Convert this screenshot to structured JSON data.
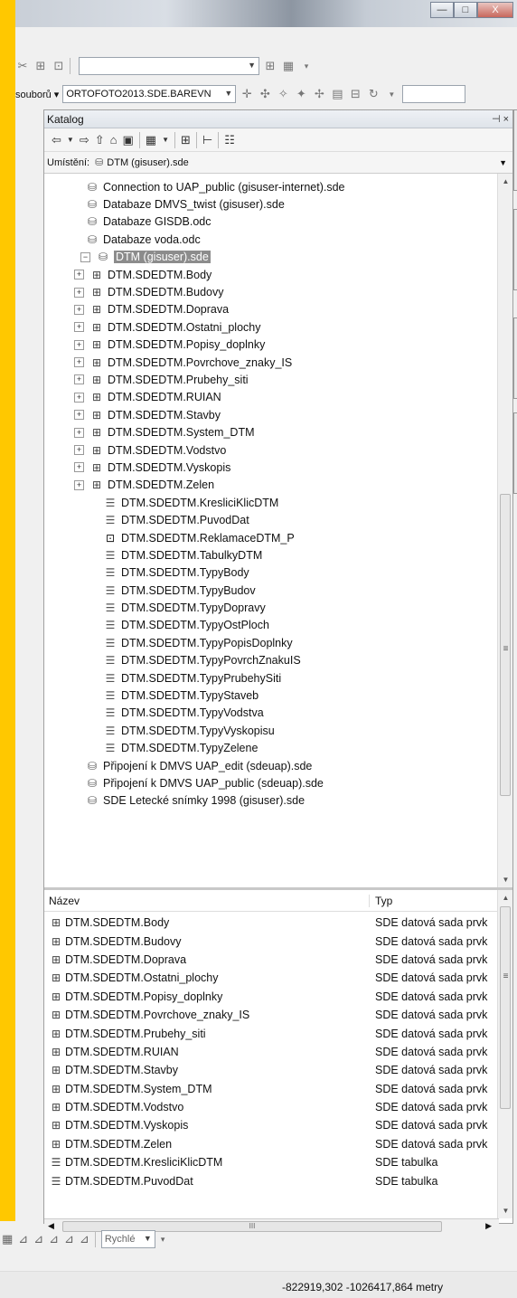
{
  "window": {
    "minimize": "—",
    "maximize": "□",
    "close": "X"
  },
  "top_toolbar": {
    "layer_combo_value": "ORTOFOTO2013.SDE.BAREVN",
    "label_prefix": "souborů ▾"
  },
  "catalog": {
    "title": "Katalog",
    "pin_label": "⊣ ×",
    "location_label": "Umístění:",
    "location_value": "DTM (gisuser).sde",
    "tree": [
      {
        "type": "db",
        "label": "Connection to UAP_public (gisuser-internet).sde",
        "indent": 1
      },
      {
        "type": "db",
        "label": "Databaze DMVS_twist (gisuser).sde",
        "indent": 1
      },
      {
        "type": "db",
        "label": "Databaze GISDB.odc",
        "indent": 1
      },
      {
        "type": "db",
        "label": "Databaze voda.odc",
        "indent": 1
      },
      {
        "type": "db-open",
        "label": "DTM (gisuser).sde",
        "indent": 0,
        "selected": true
      },
      {
        "type": "fds",
        "label": "DTM.SDEDTM.Body",
        "indent": 2
      },
      {
        "type": "fds",
        "label": "DTM.SDEDTM.Budovy",
        "indent": 2
      },
      {
        "type": "fds",
        "label": "DTM.SDEDTM.Doprava",
        "indent": 2
      },
      {
        "type": "fds",
        "label": "DTM.SDEDTM.Ostatni_plochy",
        "indent": 2
      },
      {
        "type": "fds",
        "label": "DTM.SDEDTM.Popisy_doplnky",
        "indent": 2
      },
      {
        "type": "fds",
        "label": "DTM.SDEDTM.Povrchove_znaky_IS",
        "indent": 2
      },
      {
        "type": "fds",
        "label": "DTM.SDEDTM.Prubehy_siti",
        "indent": 2
      },
      {
        "type": "fds",
        "label": "DTM.SDEDTM.RUIAN",
        "indent": 2
      },
      {
        "type": "fds",
        "label": "DTM.SDEDTM.Stavby",
        "indent": 2
      },
      {
        "type": "fds",
        "label": "DTM.SDEDTM.System_DTM",
        "indent": 2
      },
      {
        "type": "fds",
        "label": "DTM.SDEDTM.Vodstvo",
        "indent": 2
      },
      {
        "type": "fds",
        "label": "DTM.SDEDTM.Vyskopis",
        "indent": 2
      },
      {
        "type": "fds",
        "label": "DTM.SDEDTM.Zelen",
        "indent": 2
      },
      {
        "type": "tbl",
        "label": "DTM.SDEDTM.KresliciKlicDTM",
        "indent": 3
      },
      {
        "type": "tbl",
        "label": "DTM.SDEDTM.PuvodDat",
        "indent": 3
      },
      {
        "type": "fc",
        "label": "DTM.SDEDTM.ReklamaceDTM_P",
        "indent": 3
      },
      {
        "type": "tbl",
        "label": "DTM.SDEDTM.TabulkyDTM",
        "indent": 3
      },
      {
        "type": "tbl",
        "label": "DTM.SDEDTM.TypyBody",
        "indent": 3
      },
      {
        "type": "tbl",
        "label": "DTM.SDEDTM.TypyBudov",
        "indent": 3
      },
      {
        "type": "tbl",
        "label": "DTM.SDEDTM.TypyDopravy",
        "indent": 3
      },
      {
        "type": "tbl",
        "label": "DTM.SDEDTM.TypyOstPloch",
        "indent": 3
      },
      {
        "type": "tbl",
        "label": "DTM.SDEDTM.TypyPopisDoplnky",
        "indent": 3
      },
      {
        "type": "tbl",
        "label": "DTM.SDEDTM.TypyPovrchZnakuIS",
        "indent": 3
      },
      {
        "type": "tbl",
        "label": "DTM.SDEDTM.TypyPrubehySiti",
        "indent": 3
      },
      {
        "type": "tbl",
        "label": "DTM.SDEDTM.TypyStaveb",
        "indent": 3
      },
      {
        "type": "tbl",
        "label": "DTM.SDEDTM.TypyVodstva",
        "indent": 3
      },
      {
        "type": "tbl",
        "label": "DTM.SDEDTM.TypyVyskopisu",
        "indent": 3
      },
      {
        "type": "tbl",
        "label": "DTM.SDEDTM.TypyZelene",
        "indent": 3
      },
      {
        "type": "db",
        "label": "Připojení k DMVS UAP_edit (sdeuap).sde",
        "indent": 1
      },
      {
        "type": "db",
        "label": "Připojení k DMVS UAP_public (sdeuap).sde",
        "indent": 1
      },
      {
        "type": "db",
        "label": "SDE Letecké snímky 1998 (gisuser).sde",
        "indent": 1
      }
    ],
    "list_headers": {
      "name": "Název",
      "type": "Typ"
    },
    "list": [
      {
        "icon": "fds",
        "name": "DTM.SDEDTM.Body",
        "type": "SDE datová sada prvk"
      },
      {
        "icon": "fds",
        "name": "DTM.SDEDTM.Budovy",
        "type": "SDE datová sada prvk"
      },
      {
        "icon": "fds",
        "name": "DTM.SDEDTM.Doprava",
        "type": "SDE datová sada prvk"
      },
      {
        "icon": "fds",
        "name": "DTM.SDEDTM.Ostatni_plochy",
        "type": "SDE datová sada prvk"
      },
      {
        "icon": "fds",
        "name": "DTM.SDEDTM.Popisy_doplnky",
        "type": "SDE datová sada prvk"
      },
      {
        "icon": "fds",
        "name": "DTM.SDEDTM.Povrchove_znaky_IS",
        "type": "SDE datová sada prvk"
      },
      {
        "icon": "fds",
        "name": "DTM.SDEDTM.Prubehy_siti",
        "type": "SDE datová sada prvk"
      },
      {
        "icon": "fds",
        "name": "DTM.SDEDTM.RUIAN",
        "type": "SDE datová sada prvk"
      },
      {
        "icon": "fds",
        "name": "DTM.SDEDTM.Stavby",
        "type": "SDE datová sada prvk"
      },
      {
        "icon": "fds",
        "name": "DTM.SDEDTM.System_DTM",
        "type": "SDE datová sada prvk"
      },
      {
        "icon": "fds",
        "name": "DTM.SDEDTM.Vodstvo",
        "type": "SDE datová sada prvk"
      },
      {
        "icon": "fds",
        "name": "DTM.SDEDTM.Vyskopis",
        "type": "SDE datová sada prvk"
      },
      {
        "icon": "fds",
        "name": "DTM.SDEDTM.Zelen",
        "type": "SDE datová sada prvk"
      },
      {
        "icon": "tbl",
        "name": "DTM.SDEDTM.KresliciKlicDTM",
        "type": "SDE tabulka"
      },
      {
        "icon": "tbl",
        "name": "DTM.SDEDTM.PuvodDat",
        "type": "SDE tabulka"
      }
    ],
    "hscroll_grip": "III"
  },
  "bottom_toolbar": {
    "combo_value": "Rychlé"
  },
  "status": {
    "coords": "-822919,302  -1026417,864 metry"
  },
  "colors": {
    "accent_yellow": "#ffc800",
    "selection": "#8c8c8c"
  }
}
